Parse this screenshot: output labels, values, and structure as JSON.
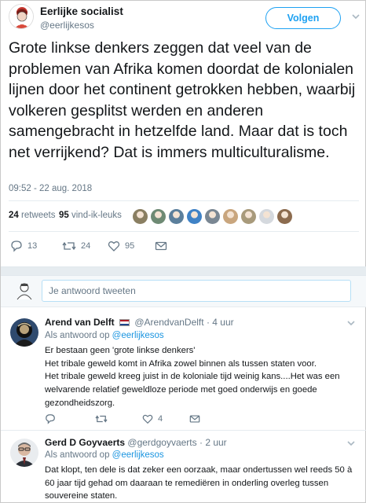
{
  "author": {
    "name": "Eerlijke socialist",
    "handle": "@eerlijkesos",
    "follow_label": "Volgen"
  },
  "tweet": {
    "text": "Grote linkse denkers zeggen dat veel van de problemen van Afrika komen doordat de kolonialen lijnen door het continent getrokken hebben, waarbij volkeren gesplitst werden en anderen samengebracht in hetzelfde land. Maar dat is toch net verrijkend? Dat is immers multiculturalisme.",
    "timestamp": "09:52 - 22 aug. 2018",
    "retweets_count": "24",
    "retweets_label": "retweets",
    "likes_count": "95",
    "likes_label": "vind-ik-leuks",
    "reply_count": "13",
    "retweet_action_count": "24",
    "like_action_count": "95",
    "liker_avatars": [
      "#8a7f62",
      "#6e8a74",
      "#5b7f9c",
      "#3f82c6",
      "#7a8793",
      "#c9a67e",
      "#a89a7b",
      "#d5d9de",
      "#8c6b4e"
    ]
  },
  "reply_box": {
    "placeholder": "Je antwoord tweeten"
  },
  "replies": [
    {
      "name": "Arend van Delft",
      "handle": "@ArendvanDelft",
      "age": "4 uur",
      "reply_to_prefix": "Als antwoord op",
      "reply_to_handle": "@eerlijkesos",
      "lines": [
        "Er bestaan geen 'grote linkse denkers'",
        "Het tribale geweld komt in Afrika zowel binnen als tussen staten voor.",
        "Het tribale geweld kreeg  juist in de koloniale tijd weinig kans....Het was een welvarende relatief geweldloze periode met goed onderwijs en goede gezondheidszorg."
      ],
      "reply_count": "",
      "retweet_count": "",
      "like_count": "4"
    },
    {
      "name": "Gerd D Goyvaerts",
      "handle": "@gerdgoyvaerts",
      "age": "2 uur",
      "reply_to_prefix": "Als antwoord op",
      "reply_to_handle": "@eerlijkesos",
      "lines": [
        "Dat klopt, ten dele is dat zeker een oorzaak, maar ondertussen wel reeds 50 à 60 jaar tijd gehad om daaraan te remediëren in onderling overleg tussen souvereine staten."
      ]
    }
  ],
  "colors": {
    "accent": "#1da1f2",
    "link": "#1b95e0",
    "text": "#14171a",
    "muted": "#657786",
    "divider": "#e6ecf0"
  }
}
